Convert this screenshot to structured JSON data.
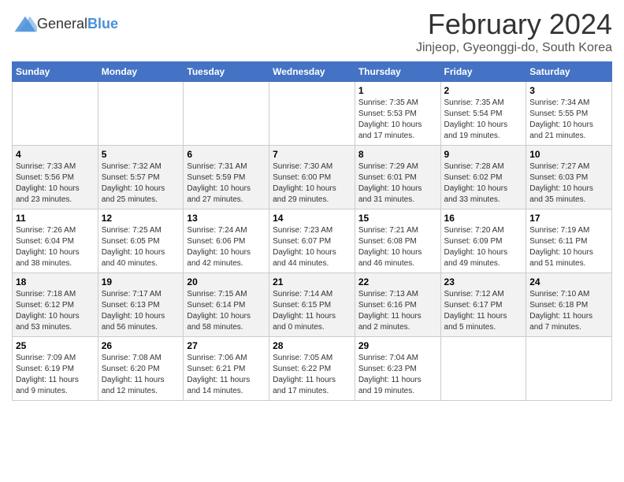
{
  "header": {
    "logo": {
      "general": "General",
      "blue": "Blue"
    },
    "title": "February 2024",
    "subtitle": "Jinjeop, Gyeonggi-do, South Korea"
  },
  "calendar": {
    "days_of_week": [
      "Sunday",
      "Monday",
      "Tuesday",
      "Wednesday",
      "Thursday",
      "Friday",
      "Saturday"
    ],
    "weeks": [
      [
        {
          "day": "",
          "info": ""
        },
        {
          "day": "",
          "info": ""
        },
        {
          "day": "",
          "info": ""
        },
        {
          "day": "",
          "info": ""
        },
        {
          "day": "1",
          "info": "Sunrise: 7:35 AM\nSunset: 5:53 PM\nDaylight: 10 hours\nand 17 minutes."
        },
        {
          "day": "2",
          "info": "Sunrise: 7:35 AM\nSunset: 5:54 PM\nDaylight: 10 hours\nand 19 minutes."
        },
        {
          "day": "3",
          "info": "Sunrise: 7:34 AM\nSunset: 5:55 PM\nDaylight: 10 hours\nand 21 minutes."
        }
      ],
      [
        {
          "day": "4",
          "info": "Sunrise: 7:33 AM\nSunset: 5:56 PM\nDaylight: 10 hours\nand 23 minutes."
        },
        {
          "day": "5",
          "info": "Sunrise: 7:32 AM\nSunset: 5:57 PM\nDaylight: 10 hours\nand 25 minutes."
        },
        {
          "day": "6",
          "info": "Sunrise: 7:31 AM\nSunset: 5:59 PM\nDaylight: 10 hours\nand 27 minutes."
        },
        {
          "day": "7",
          "info": "Sunrise: 7:30 AM\nSunset: 6:00 PM\nDaylight: 10 hours\nand 29 minutes."
        },
        {
          "day": "8",
          "info": "Sunrise: 7:29 AM\nSunset: 6:01 PM\nDaylight: 10 hours\nand 31 minutes."
        },
        {
          "day": "9",
          "info": "Sunrise: 7:28 AM\nSunset: 6:02 PM\nDaylight: 10 hours\nand 33 minutes."
        },
        {
          "day": "10",
          "info": "Sunrise: 7:27 AM\nSunset: 6:03 PM\nDaylight: 10 hours\nand 35 minutes."
        }
      ],
      [
        {
          "day": "11",
          "info": "Sunrise: 7:26 AM\nSunset: 6:04 PM\nDaylight: 10 hours\nand 38 minutes."
        },
        {
          "day": "12",
          "info": "Sunrise: 7:25 AM\nSunset: 6:05 PM\nDaylight: 10 hours\nand 40 minutes."
        },
        {
          "day": "13",
          "info": "Sunrise: 7:24 AM\nSunset: 6:06 PM\nDaylight: 10 hours\nand 42 minutes."
        },
        {
          "day": "14",
          "info": "Sunrise: 7:23 AM\nSunset: 6:07 PM\nDaylight: 10 hours\nand 44 minutes."
        },
        {
          "day": "15",
          "info": "Sunrise: 7:21 AM\nSunset: 6:08 PM\nDaylight: 10 hours\nand 46 minutes."
        },
        {
          "day": "16",
          "info": "Sunrise: 7:20 AM\nSunset: 6:09 PM\nDaylight: 10 hours\nand 49 minutes."
        },
        {
          "day": "17",
          "info": "Sunrise: 7:19 AM\nSunset: 6:11 PM\nDaylight: 10 hours\nand 51 minutes."
        }
      ],
      [
        {
          "day": "18",
          "info": "Sunrise: 7:18 AM\nSunset: 6:12 PM\nDaylight: 10 hours\nand 53 minutes."
        },
        {
          "day": "19",
          "info": "Sunrise: 7:17 AM\nSunset: 6:13 PM\nDaylight: 10 hours\nand 56 minutes."
        },
        {
          "day": "20",
          "info": "Sunrise: 7:15 AM\nSunset: 6:14 PM\nDaylight: 10 hours\nand 58 minutes."
        },
        {
          "day": "21",
          "info": "Sunrise: 7:14 AM\nSunset: 6:15 PM\nDaylight: 11 hours\nand 0 minutes."
        },
        {
          "day": "22",
          "info": "Sunrise: 7:13 AM\nSunset: 6:16 PM\nDaylight: 11 hours\nand 2 minutes."
        },
        {
          "day": "23",
          "info": "Sunrise: 7:12 AM\nSunset: 6:17 PM\nDaylight: 11 hours\nand 5 minutes."
        },
        {
          "day": "24",
          "info": "Sunrise: 7:10 AM\nSunset: 6:18 PM\nDaylight: 11 hours\nand 7 minutes."
        }
      ],
      [
        {
          "day": "25",
          "info": "Sunrise: 7:09 AM\nSunset: 6:19 PM\nDaylight: 11 hours\nand 9 minutes."
        },
        {
          "day": "26",
          "info": "Sunrise: 7:08 AM\nSunset: 6:20 PM\nDaylight: 11 hours\nand 12 minutes."
        },
        {
          "day": "27",
          "info": "Sunrise: 7:06 AM\nSunset: 6:21 PM\nDaylight: 11 hours\nand 14 minutes."
        },
        {
          "day": "28",
          "info": "Sunrise: 7:05 AM\nSunset: 6:22 PM\nDaylight: 11 hours\nand 17 minutes."
        },
        {
          "day": "29",
          "info": "Sunrise: 7:04 AM\nSunset: 6:23 PM\nDaylight: 11 hours\nand 19 minutes."
        },
        {
          "day": "",
          "info": ""
        },
        {
          "day": "",
          "info": ""
        }
      ]
    ]
  }
}
